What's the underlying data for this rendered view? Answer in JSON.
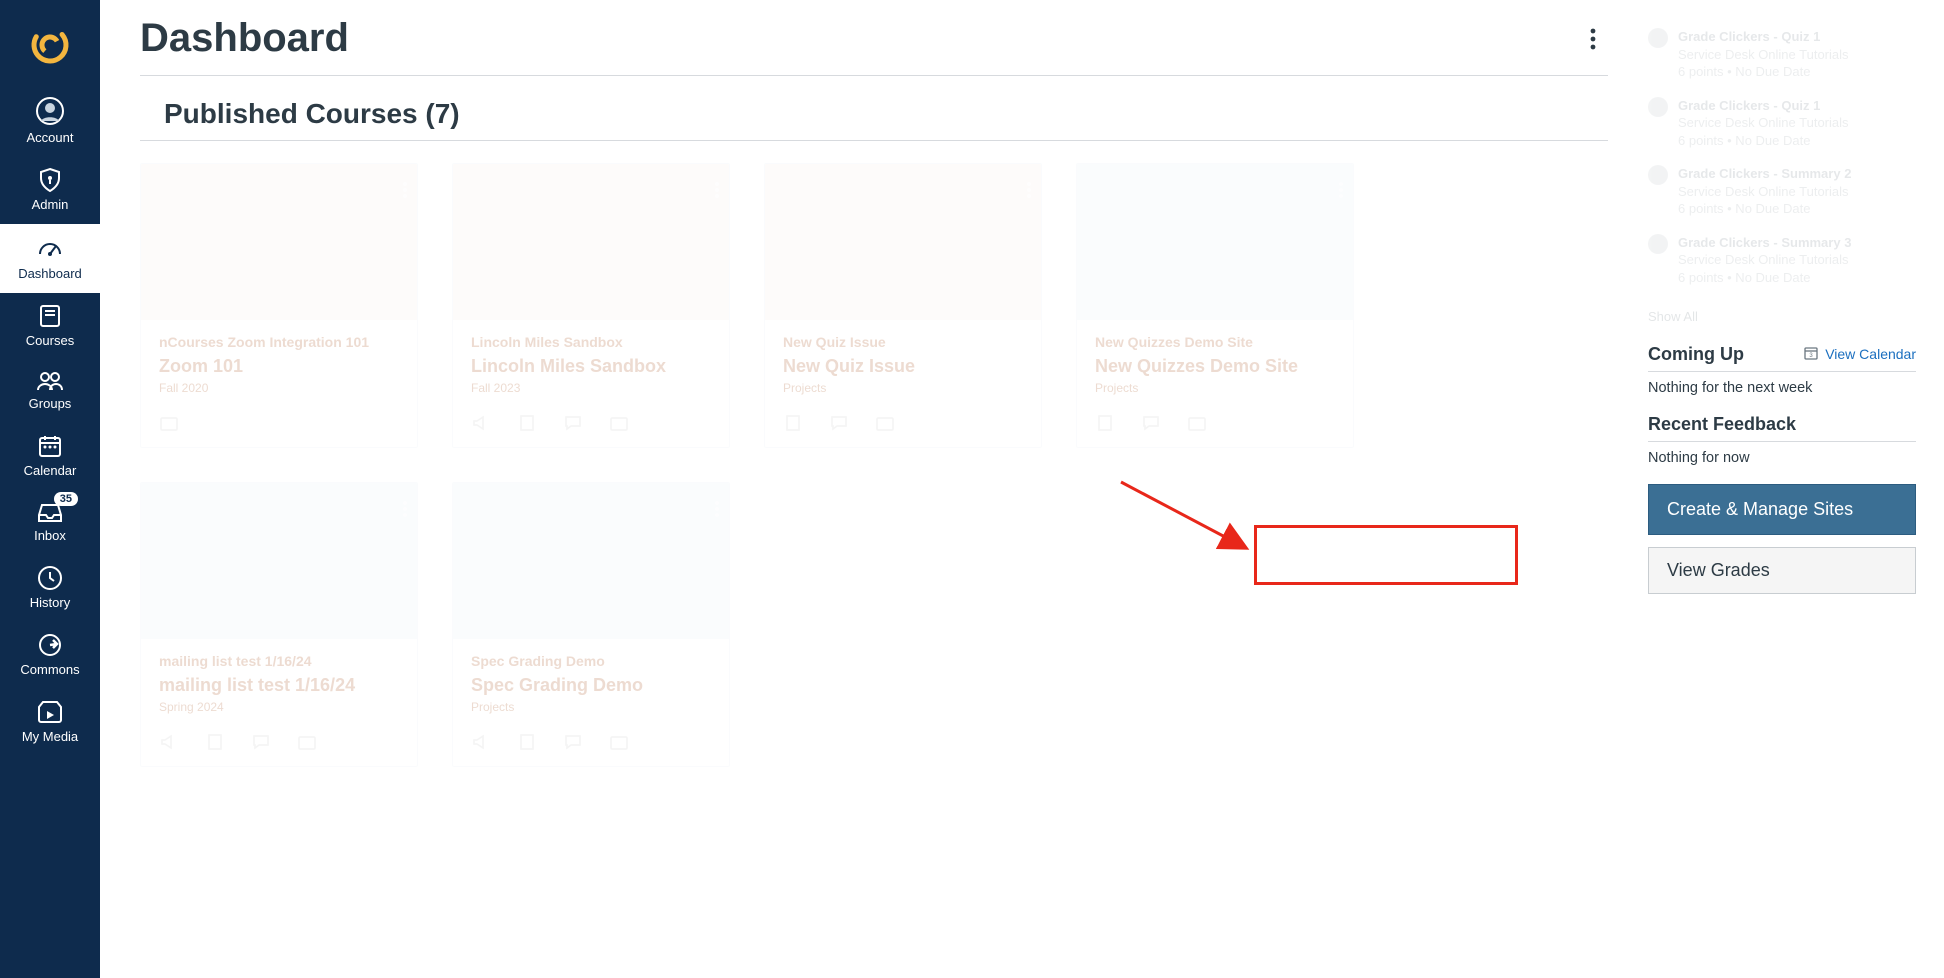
{
  "sidebar": {
    "items": [
      {
        "label": "Account"
      },
      {
        "label": "Admin"
      },
      {
        "label": "Dashboard"
      },
      {
        "label": "Courses"
      },
      {
        "label": "Groups"
      },
      {
        "label": "Calendar"
      },
      {
        "label": "Inbox",
        "badge": "35"
      },
      {
        "label": "History"
      },
      {
        "label": "Commons"
      },
      {
        "label": "My Media"
      }
    ]
  },
  "header": {
    "title": "Dashboard"
  },
  "section": {
    "title": "Published Courses (7)"
  },
  "cards": [
    {
      "title": "nCourses Zoom Integration 101",
      "sub": "Zoom 101",
      "term": "Fall 2020"
    },
    {
      "title": "Lincoln Miles Sandbox",
      "sub": "Lincoln Miles Sandbox",
      "term": "Fall 2023"
    },
    {
      "title": "New Quiz Issue",
      "sub": "New Quiz Issue",
      "term": "Projects"
    },
    {
      "title": "New Quizzes Demo Site",
      "sub": "New Quizzes Demo Site",
      "term": "Projects"
    },
    {
      "title": "mailing list test 1/16/24",
      "sub": "mailing list test 1/16/24",
      "term": "Spring 2024"
    },
    {
      "title": "Spec Grading Demo",
      "sub": "Spec Grading Demo",
      "term": "Projects"
    }
  ],
  "todo": {
    "items": [
      {
        "line1": "Grade Clickers - Quiz 1",
        "line2": "Service Desk Online Tutorials",
        "line3": "6 points • No Due Date"
      },
      {
        "line1": "Grade Clickers - Quiz 1",
        "line2": "Service Desk Online Tutorials",
        "line3": "6 points • No Due Date"
      },
      {
        "line1": "Grade Clickers - Summary 2",
        "line2": "Service Desk Online Tutorials",
        "line3": "6 points • No Due Date"
      },
      {
        "line1": "Grade Clickers - Summary 3",
        "line2": "Service Desk Online Tutorials",
        "line3": "6 points • No Due Date"
      }
    ],
    "show_all": "Show All"
  },
  "coming_up": {
    "heading": "Coming Up",
    "view_calendar": "View Calendar",
    "body": "Nothing for the next week"
  },
  "feedback": {
    "heading": "Recent Feedback",
    "body": "Nothing for now"
  },
  "buttons": {
    "create": "Create & Manage Sites",
    "grades": "View Grades"
  }
}
